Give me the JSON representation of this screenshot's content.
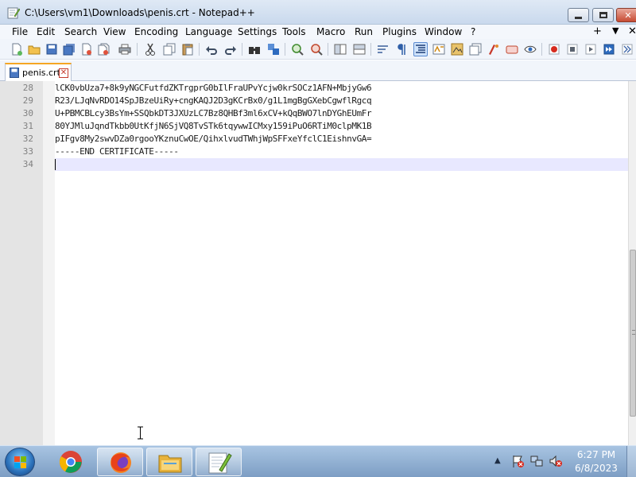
{
  "window": {
    "title": "C:\\Users\\vm1\\Downloads\\penis.crt - Notepad++",
    "min_symbol": "",
    "max_symbol": "",
    "close_symbol": "✕"
  },
  "menu": {
    "items": [
      "File",
      "Edit",
      "Search",
      "View",
      "Encoding",
      "Language",
      "Settings",
      "Tools",
      "Macro",
      "Run",
      "Plugins",
      "Window",
      "?"
    ],
    "right_plus": "+",
    "right_down": "▼",
    "right_close": "✕"
  },
  "tab": {
    "label": "penis.crt",
    "close_glyph": "✕"
  },
  "editor": {
    "lines": [
      {
        "num": "28",
        "text": "lCK0vbUza7+8k9yNGCFutfdZKTrgprG0bIlFraUPvYcjw0krSOCz1AFN+MbjyGw6"
      },
      {
        "num": "29",
        "text": "R23/LJqNvRDO14SpJBzeUiRy+cngKAQJ2D3gKCrBx0/g1L1mgBgGXebCgwflRgcq"
      },
      {
        "num": "30",
        "text": "U+PBMCBLcy3BsYm+SSQbkDT3JXUzLC7Bz8QHBf3ml6xCV+kQqBWO7lnDYGhEUmFr"
      },
      {
        "num": "31",
        "text": "80YJMluJqndTkbb0UtKfjN6SjVQ8TvSTk6tqywwICMxy159iPuO6RTiM0clpMK1B"
      },
      {
        "num": "32",
        "text": "pIFgv8My2swvDZa0rgooYKznuCwOE/QihxlvudTWhjWpSFFxeYfclC1EishnvGA="
      },
      {
        "num": "33",
        "text": "-----END CERTIFICATE-----"
      },
      {
        "num": "34",
        "text": ""
      }
    ]
  },
  "taskbar": {
    "apps": [
      "chrome-icon",
      "firefox-icon",
      "file-explorer-icon",
      "notepadpp-icon"
    ],
    "tray_arrow": "▲",
    "clock_time": "6:27 PM",
    "clock_date": "6/8/2023"
  },
  "colors": {
    "accent_tab": "#f5a623",
    "caret_line": "#e8e8ff",
    "taskbar": "#7d9ec4"
  }
}
